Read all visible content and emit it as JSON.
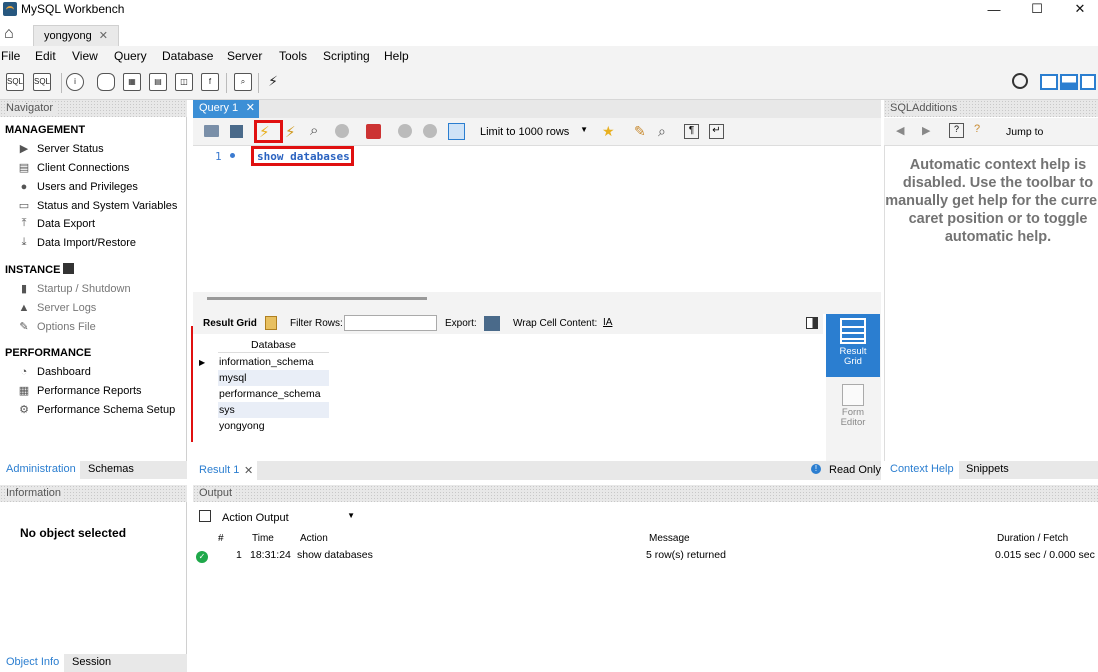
{
  "window": {
    "title": "MySQL Workbench",
    "minimize": "—",
    "maximize": "☐",
    "close": "✕"
  },
  "connection_tab": {
    "label": "yongyong",
    "close": "✕"
  },
  "menu": [
    "File",
    "Edit",
    "View",
    "Query",
    "Database",
    "Server",
    "Tools",
    "Scripting",
    "Help"
  ],
  "navigator": {
    "header": "Navigator",
    "management": {
      "title": "MANAGEMENT",
      "items": [
        "Server Status",
        "Client Connections",
        "Users and Privileges",
        "Status and System Variables",
        "Data Export",
        "Data Import/Restore"
      ]
    },
    "instance": {
      "title": "INSTANCE",
      "items": [
        "Startup / Shutdown",
        "Server Logs",
        "Options File"
      ]
    },
    "performance": {
      "title": "PERFORMANCE",
      "items": [
        "Dashboard",
        "Performance Reports",
        "Performance Schema Setup"
      ]
    },
    "tabs": [
      "Administration",
      "Schemas"
    ]
  },
  "information": {
    "header": "Information",
    "empty_text": "No object selected",
    "tabs": [
      "Object Info",
      "Session"
    ]
  },
  "query_tab": {
    "label": "Query 1",
    "close": "✕"
  },
  "query_toolbar": {
    "limit_select": "Limit to 1000 rows"
  },
  "editor": {
    "line_number": "1",
    "code": "show databases"
  },
  "result_toolbar": {
    "result_grid": "Result Grid",
    "filter_rows": "Filter Rows:",
    "export": "Export:",
    "wrap_cell": "Wrap Cell Content:"
  },
  "result_grid": {
    "column": "Database",
    "rows": [
      "information_schema",
      "mysql",
      "performance_schema",
      "sys",
      "yongyong"
    ]
  },
  "side_buttons": {
    "result_grid": "Result Grid",
    "form_editor": "Form Editor"
  },
  "result_tabbar": {
    "tab_label": "Result 1",
    "close": "✕",
    "read_only": "Read Only"
  },
  "sql_additions": {
    "header": "SQLAdditions",
    "jump_to": "Jump to",
    "help_text": "Automatic context help is disabled. Use the toolbar to manually get help for the current caret position or to toggle automatic help.",
    "tabs": [
      "Context Help",
      "Snippets"
    ]
  },
  "output": {
    "header": "Output",
    "select": "Action Output",
    "columns": [
      "#",
      "Time",
      "Action",
      "Message",
      "Duration / Fetch"
    ],
    "rows": [
      {
        "num": "1",
        "time": "18:31:24",
        "action": "show databases",
        "message": "5 row(s) returned",
        "duration": "0.015 sec / 0.000 sec"
      }
    ]
  },
  "colors": {
    "accent": "#2b7ed0",
    "highlight_box": "#e01010",
    "ok_status": "#1fa84a"
  }
}
